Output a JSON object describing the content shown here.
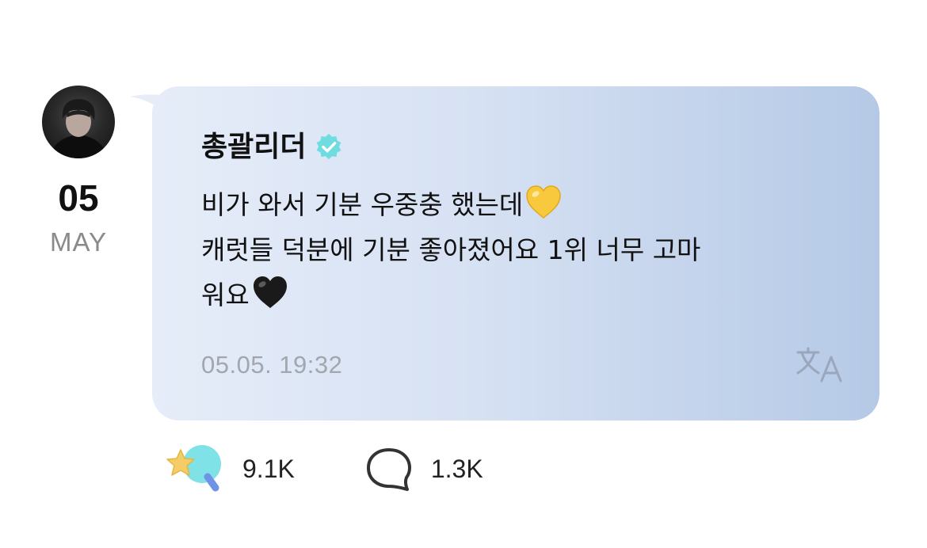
{
  "post": {
    "date": {
      "day": "05",
      "month": "MAY"
    },
    "author": {
      "name": "총괄리더",
      "verified": true,
      "verified_color": "#6fdde0"
    },
    "message_lines": [
      "비가 와서 기분 우중충 했는데",
      "캐럿들 덕분에 기분 좋아졌어요 1위 너무 고마",
      "워요"
    ],
    "emojis": {
      "line1_end": "yellow-heart",
      "line3_end": "black-heart"
    },
    "timestamp": "05.05. 19:32",
    "translate_icon": "translate-icon"
  },
  "reactions": {
    "likes": {
      "icon": "lightstick-star-icon",
      "count": "9.1K"
    },
    "comments": {
      "icon": "comment-bubble-icon",
      "count": "1.3K"
    }
  },
  "colors": {
    "bubble_start": "#e6edf9",
    "bubble_end": "#b5c9e6",
    "timestamp": "#a2a6ae",
    "month": "#8a8a8a"
  }
}
